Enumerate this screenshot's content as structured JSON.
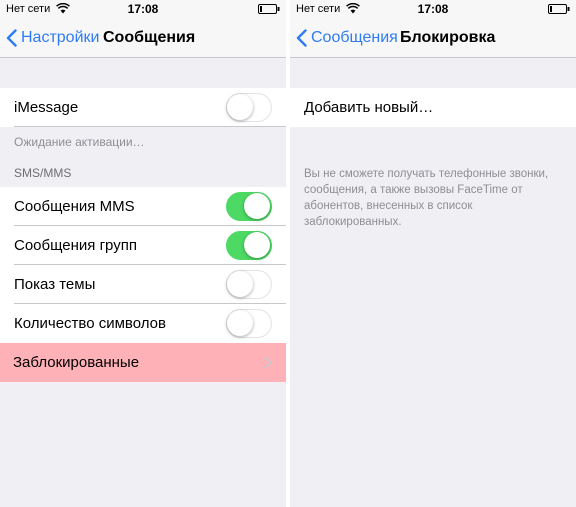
{
  "colors": {
    "accent": "#2f7bf5",
    "toggle_on": "#4cd964",
    "highlight": "#ffb1b8",
    "background": "#efeff4"
  },
  "status_bar": {
    "carrier": "Нет сети",
    "time": "17:08"
  },
  "left_screen": {
    "nav": {
      "back_label": "Настройки",
      "title": "Сообщения"
    },
    "imessage": {
      "label": "iMessage",
      "on": false
    },
    "activation_note": "Ожидание активации…",
    "sms_section_header": "SMS/MMS",
    "settings": [
      {
        "label": "Сообщения MMS",
        "on": true
      },
      {
        "label": "Сообщения групп",
        "on": true
      },
      {
        "label": "Показ темы",
        "on": false
      },
      {
        "label": "Количество символов",
        "on": false
      }
    ],
    "blocked": {
      "label": "Заблокированные",
      "icon": "chevron-right-icon"
    }
  },
  "right_screen": {
    "nav": {
      "back_label": "Сообщения",
      "title": "Блокировка"
    },
    "add_new_label": "Добавить новый…",
    "info_text": "Вы не сможете получать телефонные звонки, сообщения, а также вызовы FaceTime от абонентов, внесенных в список заблокированных."
  }
}
